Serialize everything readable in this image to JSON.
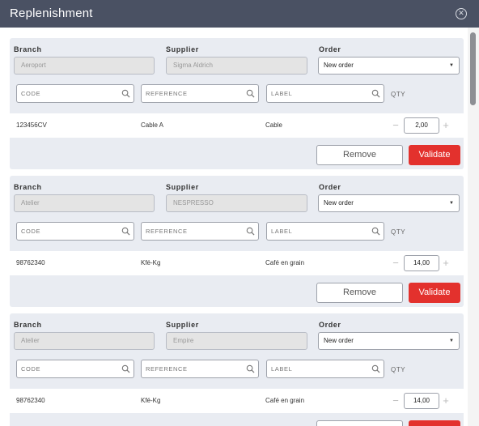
{
  "window": {
    "title": "Replenishment"
  },
  "labels": {
    "branch": "Branch",
    "supplier": "Supplier",
    "order": "Order",
    "qty": "QTY",
    "remove": "Remove",
    "validate": "Validate"
  },
  "search_placeholders": {
    "code": "CODE",
    "reference": "REFERENCE",
    "label": "LABEL"
  },
  "cards": [
    {
      "branch": "Aeroport",
      "supplier": "Sigma Aldrich",
      "order": "New order",
      "item": {
        "code": "123456CV",
        "reference": "Cable A",
        "label": "Cable",
        "qty": "2,00"
      }
    },
    {
      "branch": "Atelier",
      "supplier": "NESPRESSO",
      "order": "New order",
      "item": {
        "code": "98762340",
        "reference": "Kfé-Kg",
        "label": "Café en grain",
        "qty": "14,00"
      }
    },
    {
      "branch": "Atelier",
      "supplier": "Empire",
      "order": "New order",
      "item": {
        "code": "98762340",
        "reference": "Kfé-Kg",
        "label": "Café en grain",
        "qty": "14,00"
      }
    }
  ],
  "colors": {
    "titlebar": "#4a5163",
    "card": "#e9ecf2",
    "validate": "#e3312d"
  },
  "icons": {
    "close": "close-circle-icon",
    "search": "search-icon",
    "dropdown": "caret-down-icon"
  }
}
